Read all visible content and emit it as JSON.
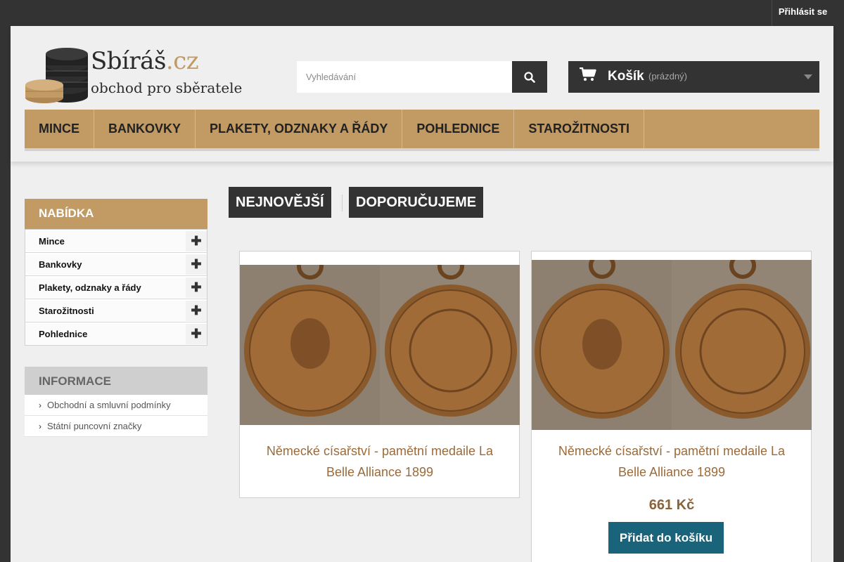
{
  "topbar": {
    "login_label": "Přihlásit se"
  },
  "header": {
    "logo_name": "Sbíráš",
    "logo_tld": ".cz",
    "logo_tagline": "obchod pro sběratele",
    "search_placeholder": "Vyhledávání",
    "cart_label": "Košík",
    "cart_status": "(prázdný)"
  },
  "nav": {
    "items": [
      {
        "label": "MINCE"
      },
      {
        "label": "BANKOVKY"
      },
      {
        "label": "PLAKETY, ODZNAKY A ŘÁDY"
      },
      {
        "label": "POHLEDNICE"
      },
      {
        "label": "STAROŽITNOSTI"
      }
    ]
  },
  "sidebar": {
    "title": "NABÍDKA",
    "items": [
      {
        "label": "Mince"
      },
      {
        "label": "Bankovky"
      },
      {
        "label": "Plakety, odznaky a řády"
      },
      {
        "label": "Starožitnosti"
      },
      {
        "label": "Pohlednice"
      }
    ]
  },
  "info": {
    "title": "INFORMACE",
    "items": [
      {
        "label": "Obchodní a smluvní podmínky"
      },
      {
        "label": "Státní puncovní značky"
      }
    ]
  },
  "tabs": [
    {
      "label": "NEJNOVĚJŠÍ"
    },
    {
      "label": "DOPORUČUJEME"
    }
  ],
  "products": [
    {
      "title": "Německé císařství - pamětní medaile La Belle Alliance 1899"
    },
    {
      "title": "Německé císařství - pamětní medaile La Belle Alliance 1899",
      "price": "661 Kč",
      "add_label": "Přidat do košíku"
    }
  ],
  "colors": {
    "accent": "#c29a63",
    "dark": "#333333",
    "button": "#19647a",
    "price": "#8a633a"
  }
}
